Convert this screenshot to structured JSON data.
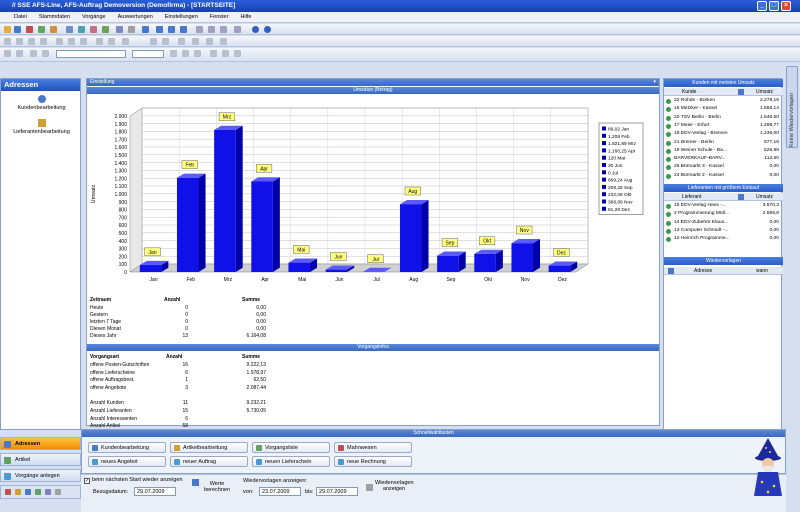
{
  "window": {
    "title": "// SSE AFS-Line, AFS-Auftrag Demoversion (Demofirma) - [STARTSEITE]",
    "minimize": "_",
    "maximize": "□",
    "close": "×"
  },
  "menu": [
    "Datei",
    "Stammdaten",
    "Vorgänge",
    "Auswertungen",
    "Einstellungen",
    "Fenster",
    "Hilfe"
  ],
  "left_panel": {
    "title": "Adressen",
    "items": [
      "Kundenbearbeitung",
      "Lieferantenbearbeitung"
    ],
    "nav": [
      "Adressen",
      "Artikel",
      "Vorgänge anlegen"
    ]
  },
  "main": {
    "header_label": "Einstellung",
    "chart_caption": "Umsätze (Betrag)",
    "stats": {
      "headers": [
        "Zeitraum",
        "Anzahl",
        "Summe"
      ],
      "rows": [
        {
          "label": "Heute",
          "count": "0",
          "sum": "0,00"
        },
        {
          "label": "Gestern",
          "count": "0",
          "sum": "0,00"
        },
        {
          "label": "letzten 7 Tage",
          "count": "0",
          "sum": "0,00"
        },
        {
          "label": "Diesen Monat",
          "count": "0",
          "sum": "0,00"
        },
        {
          "label": "Dieses Jahr",
          "count": "13",
          "sum": "6.164,08"
        }
      ]
    },
    "vorgang_bar": "Vorgangsinfos",
    "vorgang": {
      "headers": [
        "Vorgangsart",
        "Anzahl",
        "Summe"
      ],
      "rows": [
        {
          "label": "offene Posten-Gutschriften",
          "count": "16",
          "sum": "9.222,13"
        },
        {
          "label": "offene Lieferscheine",
          "count": "6",
          "sum": "1.978,97"
        },
        {
          "label": "offene Auftragsbest.",
          "count": "1",
          "sum": "62,50"
        },
        {
          "label": "offene Angebote",
          "count": "3",
          "sum": "2.087,44"
        },
        {
          "label": "Anzahl Kunden",
          "count": "11",
          "sum": "9.232,21"
        },
        {
          "label": "Anzahl Lieferanten",
          "count": "15",
          "sum": "5.730,05"
        },
        {
          "label": "Anzahl Interessenten",
          "count": "6",
          "sum": ""
        },
        {
          "label": "Anzahl Artikel",
          "count": "58",
          "sum": ""
        }
      ]
    }
  },
  "right_panel": {
    "customers_title": "Kunden mit meisten Umsatz",
    "customers_headers": [
      "Kunde",
      "Umsatz"
    ],
    "customers": [
      {
        "name": "22 Rohde - Borken",
        "value": "2.278,16"
      },
      {
        "name": "16 Metzker - Kassel",
        "value": "1.555,14"
      },
      {
        "name": "20 TSV Berlin - Berlin",
        "value": "1.548,50"
      },
      {
        "name": "17 Meier - Erfurt",
        "value": "1.298,77"
      },
      {
        "name": "18 EDV-Verlag - Bremen",
        "value": "1.236,00"
      },
      {
        "name": "21 Bremer - Berlin",
        "value": "677,16"
      },
      {
        "name": "19 Weiner Schule - Ba...",
        "value": "525,98"
      },
      {
        "name": "BARVERKAUF-BARV...",
        "value": "112,50"
      },
      {
        "name": "25 Bürmarkt 3 - Kassel",
        "value": "0,00"
      },
      {
        "name": "24 Bürmarkt 2 - Kassel",
        "value": "0,00"
      }
    ],
    "suppliers_title": "Lieferanten mit größtem Einkauf",
    "suppliers_headers": [
      "Lieferant",
      "Umsatz"
    ],
    "suppliers": [
      {
        "name": "15 EDV-Verlag Hans -...",
        "value": "3.870,3"
      },
      {
        "name": "2 Programmierung Müll...",
        "value": "2.559,8"
      },
      {
        "name": "14 EDV-Zubehör Klaus...",
        "value": "0,00"
      },
      {
        "name": "13 Computer Schmidt -...",
        "value": "0,00"
      },
      {
        "name": "12 Heinrich Programme...",
        "value": "0,00"
      }
    ],
    "wiedervorlagen_title": "Wiedervorlagen",
    "wiedervorlagen_headers": [
      "Adresse",
      "wann"
    ]
  },
  "side_tab": "Keine Wiedervorlagen",
  "quick": {
    "title": "Schnellwahltasten",
    "buttons": [
      "Kundenbearbeitung",
      "Artikelbearbeitung",
      "Vorgangsliste",
      "Mahnwesen",
      "neues Angebot",
      "neuer Auftrag",
      "neuen Lieferschein",
      "neue Rechnung"
    ]
  },
  "status": {
    "checkbox_label": "beim nächsten Start wieder anzeigen",
    "bezugsdatum_label": "Bezugsdatum:",
    "bezugsdatum": "29.07.2009",
    "werte_berechnen": "Werte berechnen",
    "wiedervorlagen_label": "Wiedervorlagen anzeigen:",
    "von_label": "von:",
    "von": "23.07.2009",
    "bis_label": "bis:",
    "bis": "29.07.2009",
    "show_label": "Wiedervorlagen anzeigen"
  },
  "chart_data": {
    "type": "bar",
    "ylabel": "Umsatz",
    "ylim": [
      0,
      2000
    ],
    "ticks": [
      "0",
      "100",
      "200",
      "300",
      "400",
      "500",
      "600",
      "700",
      "800",
      "900",
      "1.000",
      "1.100",
      "1.200",
      "1.300",
      "1.400",
      "1.500",
      "1.600",
      "1.700",
      "1.800",
      "1.900",
      "2.000"
    ],
    "categories": [
      "Jan",
      "Feb",
      "Mrz",
      "Apr",
      "Mai",
      "Jun",
      "Jul",
      "Aug",
      "Sep",
      "Okt",
      "Nov",
      "Dez"
    ],
    "bar_labels": [
      "Jan",
      "Feb",
      "Mrz",
      "Apr",
      "Mai",
      "Jun",
      "Jul",
      "Aug",
      "Sep",
      "Okt",
      "Nov",
      "Dez"
    ],
    "values": [
      89.02,
      1208,
      1821.89,
      1160.25,
      120,
      30,
      0,
      869.24,
      208.25,
      232.08,
      368.89,
      81.28
    ],
    "legend": [
      "89,02 Jan",
      "1.208 Feb",
      "1.821,89 Mrz",
      "1.160,25 Apr",
      "120 Mai",
      "30 Jun",
      "0 Jul",
      "869,24 Aug",
      "208,25 Sep",
      "232,08 Okt",
      "368,89 Nov",
      "81,28 Dez"
    ],
    "colors": {
      "bar": "#1010e8",
      "bar_top": "#5a5aff",
      "bar_side": "#0000a8",
      "floor": "#d0d0d0",
      "wall": "#ffffff"
    }
  }
}
